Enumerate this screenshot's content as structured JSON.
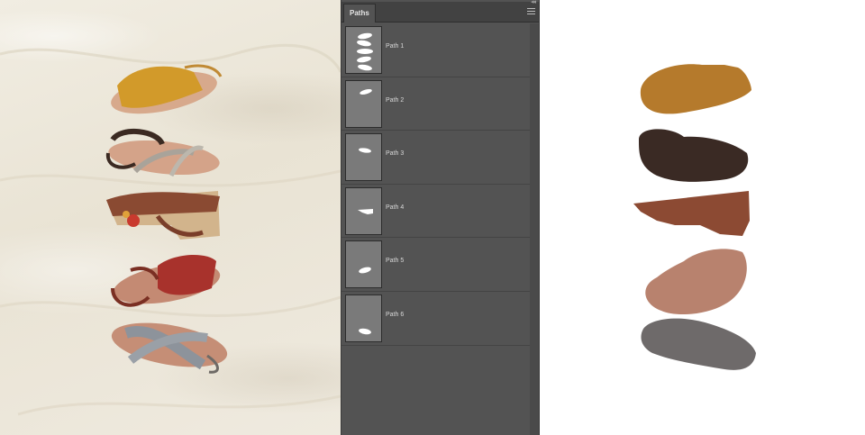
{
  "panel": {
    "tab_label": "Paths",
    "paths": [
      {
        "label": "Path 1"
      },
      {
        "label": "Path 2"
      },
      {
        "label": "Path 3"
      },
      {
        "label": "Path 4"
      },
      {
        "label": "Path 5"
      },
      {
        "label": "Path 6"
      }
    ]
  },
  "icons": {
    "panel_menu": "hamburger-menu-icon",
    "collapse": "collapse-arrows-icon"
  },
  "colors": {
    "panel_bg": "#535353",
    "sandal_mustard": "#b57a2c",
    "sandal_dark_brown": "#3a2a24",
    "sandal_rust": "#8c4a33",
    "sandal_pink": "#b8826e",
    "sandal_grey": "#6e6a6a"
  }
}
